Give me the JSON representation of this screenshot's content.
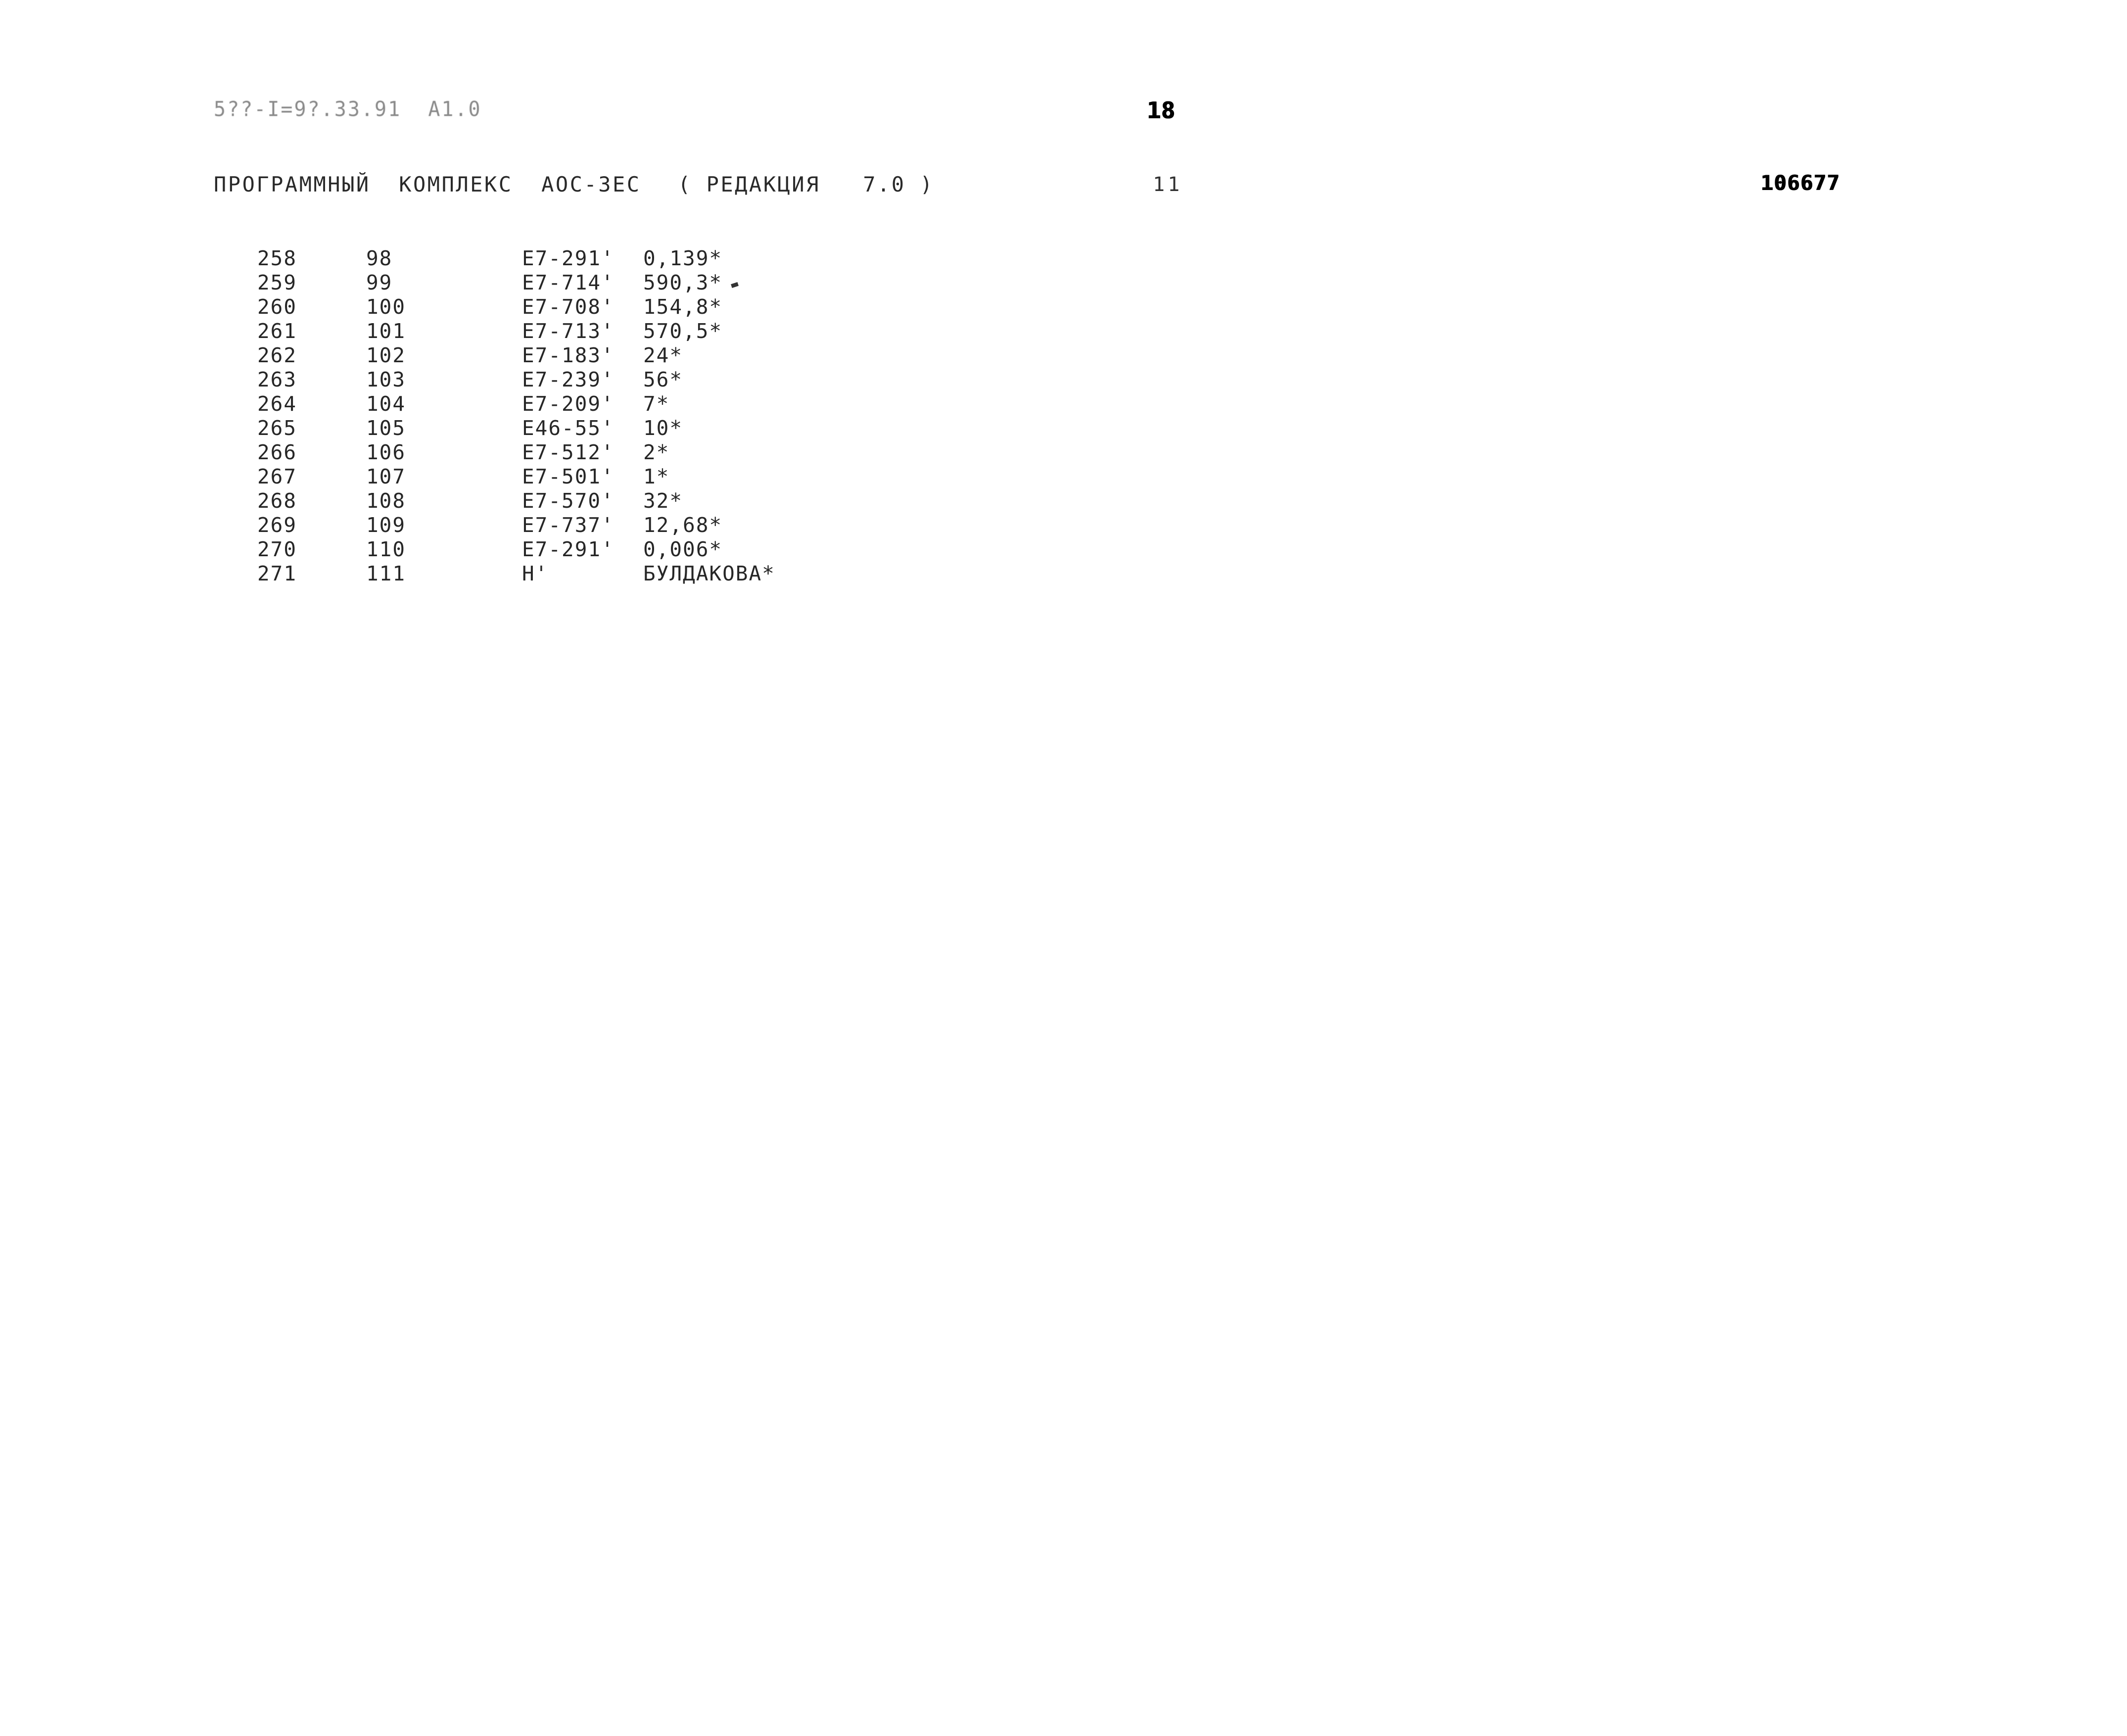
{
  "document": {
    "stamp_line": "5??-I=9?.33.91  A1.0",
    "header_title": "ПРОГРАММНЫЙ  КОМПЛЕКС  АОС-ЗЕС",
    "header_revision": "( РЕДАКЦИЯ   7.0 )",
    "page_number_top": "18",
    "page_number_sub": "11",
    "doc_number": "106677"
  },
  "listing": {
    "rows": [
      {
        "index": "258",
        "seq": "98",
        "code": "E7-291'",
        "value": "0,139*"
      },
      {
        "index": "259",
        "seq": "99",
        "code": "E7-714'",
        "value": "590,3*"
      },
      {
        "index": "260",
        "seq": "100",
        "code": "E7-708'",
        "value": "154,8*"
      },
      {
        "index": "261",
        "seq": "101",
        "code": "E7-713'",
        "value": "570,5*"
      },
      {
        "index": "262",
        "seq": "102",
        "code": "E7-183'",
        "value": "24*"
      },
      {
        "index": "263",
        "seq": "103",
        "code": "E7-239'",
        "value": "56*"
      },
      {
        "index": "264",
        "seq": "104",
        "code": "E7-209'",
        "value": "7*"
      },
      {
        "index": "265",
        "seq": "105",
        "code": "E46-55'",
        "value": "10*"
      },
      {
        "index": "266",
        "seq": "106",
        "code": "E7-512'",
        "value": "2*"
      },
      {
        "index": "267",
        "seq": "107",
        "code": "E7-501'",
        "value": "1*"
      },
      {
        "index": "268",
        "seq": "108",
        "code": "E7-570'",
        "value": "32*"
      },
      {
        "index": "269",
        "seq": "109",
        "code": "E7-737'",
        "value": "12,68*"
      },
      {
        "index": "270",
        "seq": "110",
        "code": "E7-291'",
        "value": "0,006*"
      },
      {
        "index": "271",
        "seq": "111",
        "code": "Н'",
        "value": "БУЛДАКОВА*"
      }
    ]
  }
}
